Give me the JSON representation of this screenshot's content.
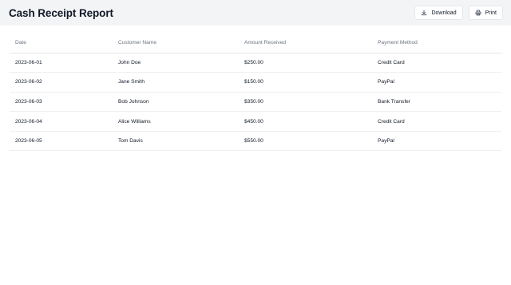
{
  "header": {
    "title": "Cash Receipt Report",
    "download_label": "Download",
    "print_label": "Print"
  },
  "table": {
    "columns": [
      "Date",
      "Customer Name",
      "Amount Received",
      "Payment Method"
    ],
    "rows": [
      [
        "2023-06-01",
        "John Doe",
        "$250.00",
        "Credit Card"
      ],
      [
        "2023-06-02",
        "Jane Smith",
        "$150.00",
        "PayPal"
      ],
      [
        "2023-06-03",
        "Bob Johnson",
        "$350.00",
        "Bank Transfer"
      ],
      [
        "2023-06-04",
        "Alice Williams",
        "$450.00",
        "Credit Card"
      ],
      [
        "2023-06-05",
        "Tom Davis",
        "$550.00",
        "PayPal"
      ]
    ]
  },
  "icons": {
    "download": "download-icon",
    "print": "printer-icon"
  }
}
